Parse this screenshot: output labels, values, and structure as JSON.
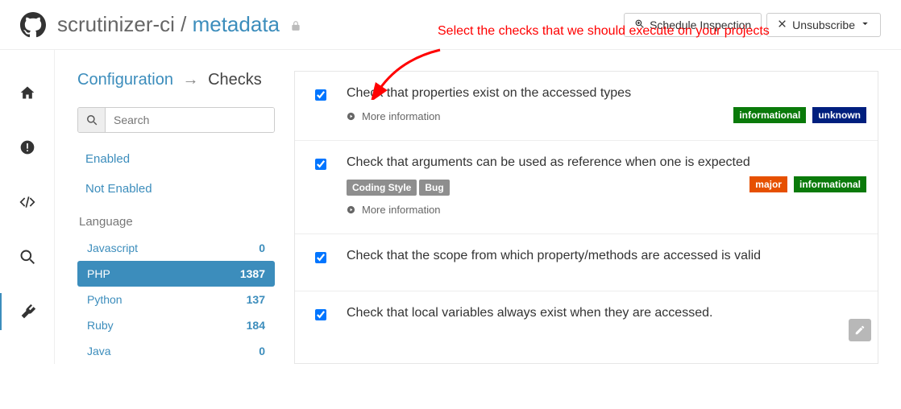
{
  "header": {
    "owner": "scrutinizer-ci",
    "sep": " / ",
    "repo": "metadata",
    "schedule_label": "Schedule Inspection",
    "unsubscribe_label": "Unsubscribe"
  },
  "breadcrumb": {
    "parent": "Configuration",
    "current": "Checks"
  },
  "search": {
    "placeholder": "Search"
  },
  "filters": {
    "enabled": "Enabled",
    "not_enabled": "Not Enabled"
  },
  "language": {
    "heading": "Language",
    "items": [
      {
        "name": "Javascript",
        "count": "0",
        "active": false
      },
      {
        "name": "PHP",
        "count": "1387",
        "active": true
      },
      {
        "name": "Python",
        "count": "137",
        "active": false
      },
      {
        "name": "Ruby",
        "count": "184",
        "active": false
      },
      {
        "name": "Java",
        "count": "0",
        "active": false
      }
    ]
  },
  "annotation": {
    "text": "Select the checks that we should execute on your projects"
  },
  "checks": [
    {
      "checked": true,
      "title": "Check that properties exist on the accessed types",
      "tags": [],
      "badges": [
        {
          "label": "informational",
          "cls": "b-info"
        },
        {
          "label": "unknown",
          "cls": "b-unknown"
        }
      ],
      "more": "More information"
    },
    {
      "checked": true,
      "title": "Check that arguments can be used as reference when one is expected",
      "tags": [
        "Coding Style",
        "Bug"
      ],
      "badges": [
        {
          "label": "major",
          "cls": "b-major"
        },
        {
          "label": "informational",
          "cls": "b-info"
        }
      ],
      "more": "More information"
    },
    {
      "checked": true,
      "title": "Check that the scope from which property/methods are accessed is valid",
      "tags": [],
      "badges": [],
      "more": null
    },
    {
      "checked": true,
      "title": "Check that local variables always exist when they are accessed.",
      "tags": [],
      "badges": [],
      "more": null
    }
  ]
}
